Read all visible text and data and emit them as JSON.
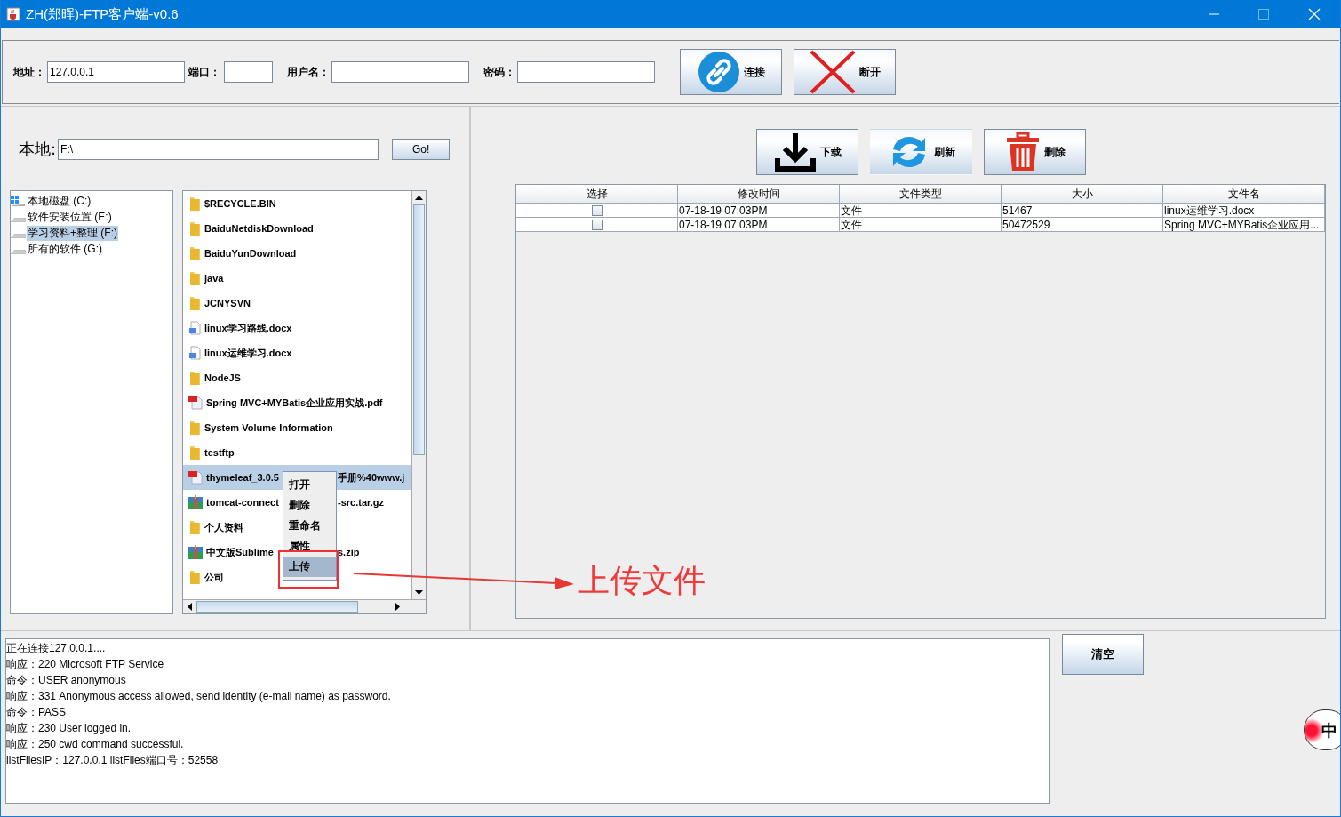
{
  "window": {
    "title": "ZH(郑晖)-FTP客户端-v0.6"
  },
  "connection": {
    "fields": [
      {
        "label": "地址：",
        "value": "127.0.0.1"
      },
      {
        "label": "端口："
      },
      {
        "label": "用户名："
      },
      {
        "label": "密码："
      }
    ],
    "buttons": [
      {
        "label": "连接",
        "kind": "connect"
      },
      {
        "label": "断开",
        "kind": "disconnect"
      }
    ]
  },
  "local": {
    "label": "本地:",
    "path": "F:\\",
    "go_button": "Go!",
    "drives": [
      {
        "name": "本地磁盘 (C:)",
        "kind": "system",
        "selected": false
      },
      {
        "name": "软件安装位置 (E:)",
        "kind": "disk",
        "selected": false
      },
      {
        "name": "学习资料+整理 (F:)",
        "kind": "disk",
        "selected": true
      },
      {
        "name": "所有的软件 (G:)",
        "kind": "disk",
        "selected": false
      }
    ],
    "files": [
      {
        "name": "$RECYCLE.BIN",
        "kind": "folder",
        "selected": false
      },
      {
        "name": "BaiduNetdiskDownload",
        "kind": "folder",
        "selected": false
      },
      {
        "name": "BaiduYunDownload",
        "kind": "folder",
        "selected": false
      },
      {
        "name": "java",
        "kind": "folder",
        "selected": false
      },
      {
        "name": "JCNYSVN",
        "kind": "folder",
        "selected": false
      },
      {
        "name": "linux学习路线.docx",
        "kind": "doc",
        "selected": false
      },
      {
        "name": "linux运维学习.docx",
        "kind": "doc",
        "selected": false
      },
      {
        "name": "NodeJS",
        "kind": "folder",
        "selected": false
      },
      {
        "name": "Spring MVC+MYBatis企业应用实战.pdf",
        "kind": "pdf",
        "selected": false
      },
      {
        "name": "System Volume Information",
        "kind": "folder",
        "selected": false
      },
      {
        "name": "testftp",
        "kind": "folder",
        "selected": false
      },
      {
        "name": "thymeleaf_3.0.5",
        "name_end": "手册%40www.j",
        "kind": "pdf",
        "selected": true
      },
      {
        "name": "tomcat-connect",
        "name_end": "-src.tar.gz",
        "kind": "archive",
        "selected": false
      },
      {
        "name": "个人资料",
        "kind": "folder",
        "selected": false
      },
      {
        "name": "中文版Sublime",
        "name_end": "s.zip",
        "kind": "archive",
        "selected": false
      },
      {
        "name": "公司",
        "kind": "folder",
        "selected": false
      }
    ],
    "context_menu": [
      {
        "label": "打开",
        "selected": false
      },
      {
        "label": "删除",
        "selected": false
      },
      {
        "label": "重命名",
        "selected": false
      },
      {
        "label": "属性",
        "selected": false
      },
      {
        "label": "上传",
        "selected": true
      }
    ]
  },
  "annotation": {
    "text": "上传文件"
  },
  "remote": {
    "buttons": [
      {
        "label": "下载",
        "kind": "download"
      },
      {
        "label": "刷新",
        "kind": "refresh"
      },
      {
        "label": "删除",
        "kind": "delete"
      }
    ],
    "table": {
      "columns": [
        "选择",
        "修改时间",
        "文件类型",
        "大小",
        "文件名"
      ],
      "rows": [
        {
          "checked": false,
          "modified": "07-18-19  07:03PM",
          "type": "文件",
          "size": "51467",
          "name": "linux运维学习.docx"
        },
        {
          "checked": false,
          "modified": "07-18-19  07:03PM",
          "type": "文件",
          "size": "50472529",
          "name": "Spring MVC+MYBatis企业应用..."
        }
      ]
    }
  },
  "log": {
    "lines": [
      "正在连接127.0.0.1....",
      "响应：220 Microsoft FTP Service",
      "命令：USER anonymous",
      "响应：331 Anonymous access allowed, send identity (e-mail name) as password.",
      "命令：PASS",
      "响应：230 User logged in.",
      "响应：250 cwd command successful.",
      "listFilesIP：127.0.0.1  listFiles端口号：52558"
    ],
    "clear_button": "清空"
  },
  "ime_badge": "中"
}
